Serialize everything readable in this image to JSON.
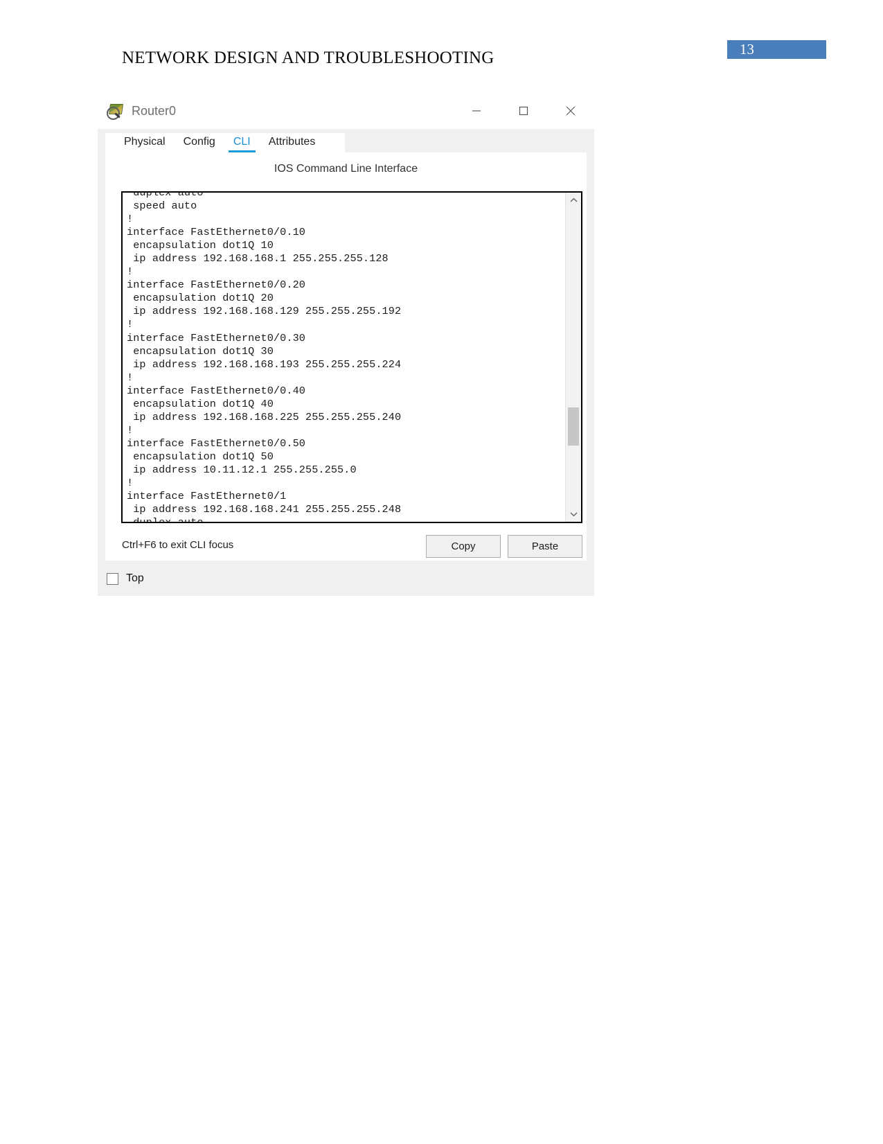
{
  "document": {
    "header_title": "NETWORK DESIGN AND TROUBLESHOOTING",
    "page_number": "13",
    "badge_color": "#4a7ebb"
  },
  "window": {
    "title": "Router0",
    "icon": "router-magnifier-icon",
    "controls": {
      "minimize": "minimize-icon",
      "maximize": "maximize-icon",
      "close": "close-icon"
    }
  },
  "tabs": [
    {
      "label": "Physical",
      "active": false
    },
    {
      "label": "Config",
      "active": false
    },
    {
      "label": "CLI",
      "active": true
    },
    {
      "label": "Attributes",
      "active": false
    }
  ],
  "cli": {
    "caption": "IOS Command Line Interface",
    "accent_color": "#1e9ad6",
    "terminal_text": " duplex auto\n speed auto\n!\ninterface FastEthernet0/0.10\n encapsulation dot1Q 10\n ip address 192.168.168.1 255.255.255.128\n!\ninterface FastEthernet0/0.20\n encapsulation dot1Q 20\n ip address 192.168.168.129 255.255.255.192\n!\ninterface FastEthernet0/0.30\n encapsulation dot1Q 30\n ip address 192.168.168.193 255.255.255.224\n!\ninterface FastEthernet0/0.40\n encapsulation dot1Q 40\n ip address 192.168.168.225 255.255.255.240\n!\ninterface FastEthernet0/0.50\n encapsulation dot1Q 50\n ip address 10.11.12.1 255.255.255.0\n!\ninterface FastEthernet0/1\n ip address 192.168.168.241 255.255.255.248\n duplex auto",
    "focus_hint": "Ctrl+F6 to exit CLI focus",
    "copy_label": "Copy",
    "paste_label": "Paste",
    "scroll_up_icon": "chevron-up-icon",
    "scroll_down_icon": "chevron-down-icon"
  },
  "bottom": {
    "top_checkbox_label": "Top",
    "top_checkbox_checked": false
  }
}
